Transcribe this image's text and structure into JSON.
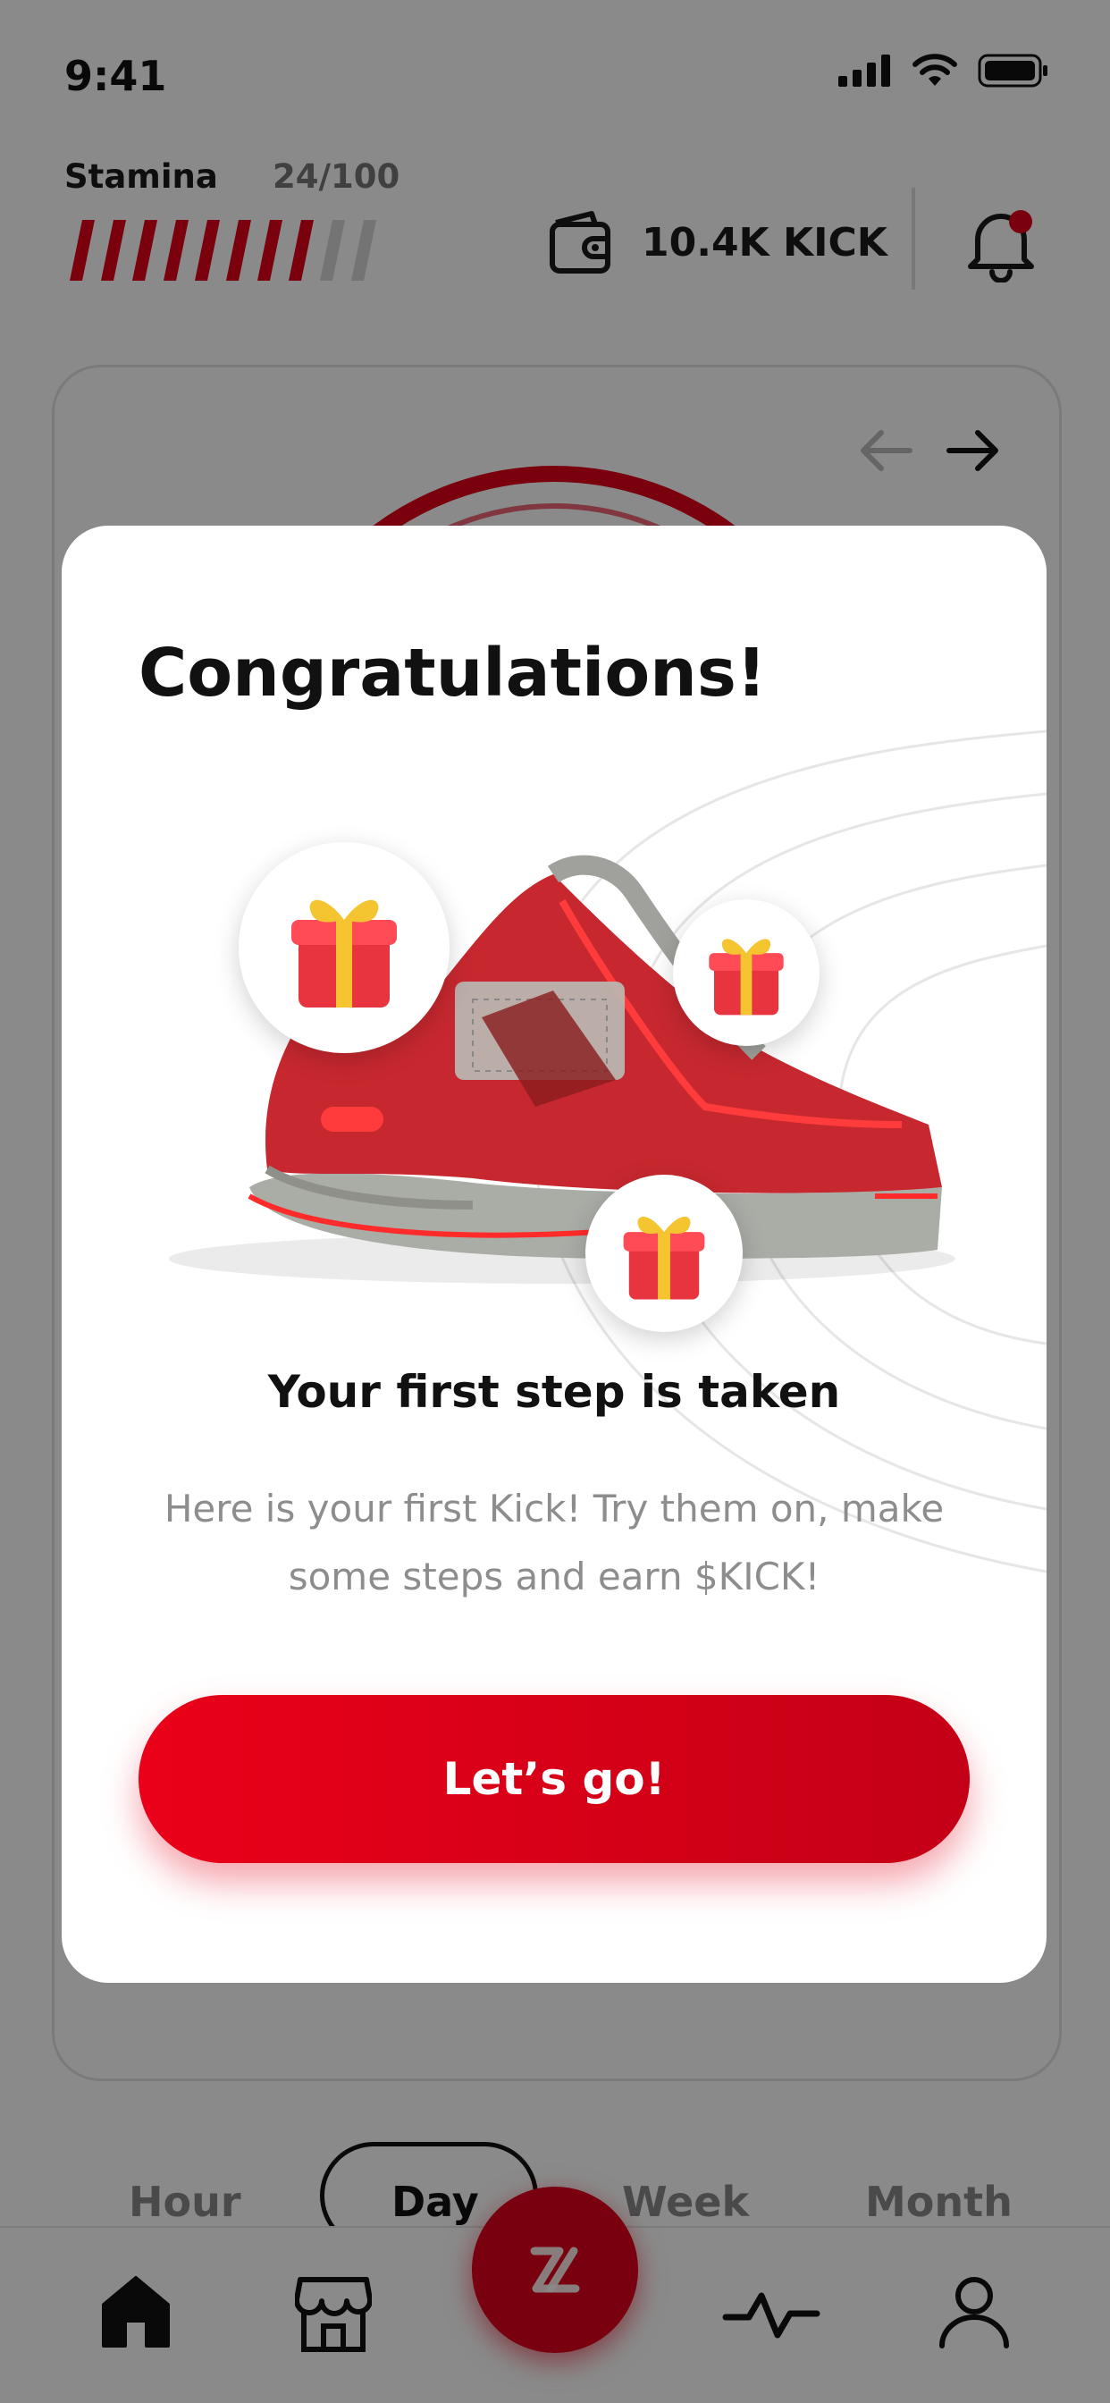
{
  "status_bar": {
    "time": "9:41"
  },
  "header": {
    "stamina_label": "Stamina",
    "stamina_value": "24/100",
    "stamina_fraction": 0.24,
    "wallet_amount": "10.4K KICK"
  },
  "period_tabs": {
    "items": [
      "Hour",
      "Day",
      "Week",
      "Month"
    ],
    "selected": "Day"
  },
  "modal": {
    "title": "Congratulations!",
    "subtitle": "Your first step is taken",
    "body": "Here is your first Kick! Try them on, make some steps and earn $KICK!",
    "button_label": "Let’s go!"
  },
  "bottom_nav": {
    "items": [
      "home-icon",
      "store-icon",
      "kick-logo-icon",
      "activity-icon",
      "profile-icon"
    ]
  },
  "colors": {
    "accent": "#e2001a",
    "text": "#111111",
    "muted": "#8d8d8d",
    "overlay": "rgba(0,0,0,0.46)"
  }
}
